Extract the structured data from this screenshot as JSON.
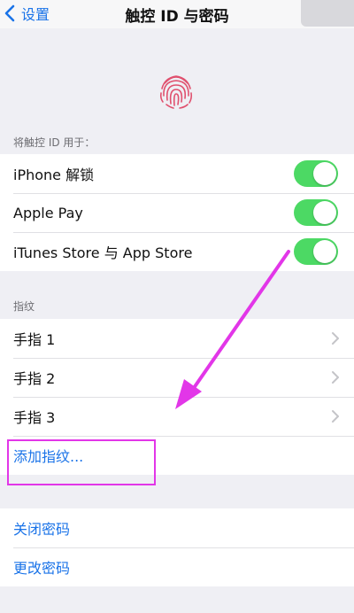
{
  "nav": {
    "back_label": "设置",
    "title": "触控 ID 与密码"
  },
  "touch_id_section": {
    "header": "将触控 ID 用于：",
    "items": [
      {
        "label": "iPhone 解锁",
        "enabled": true
      },
      {
        "label": "Apple Pay",
        "enabled": true
      },
      {
        "label": "iTunes Store 与 App Store",
        "enabled": true
      }
    ]
  },
  "fingerprints_section": {
    "header": "指纹",
    "items": [
      {
        "label": "手指 1"
      },
      {
        "label": "手指 2"
      },
      {
        "label": "手指 3"
      }
    ],
    "add_label": "添加指纹..."
  },
  "passcode_section": {
    "items": [
      {
        "label": "关闭密码"
      },
      {
        "label": "更改密码"
      }
    ]
  },
  "colors": {
    "accent": "#1a73e8",
    "toggle_on": "#4cd964",
    "annotation": "#e236e8",
    "fingerprint": "#e0506e"
  },
  "icons": {
    "back": "chevron-left-icon",
    "fingerprint": "fingerprint-icon",
    "disclosure": "chevron-right-icon"
  }
}
